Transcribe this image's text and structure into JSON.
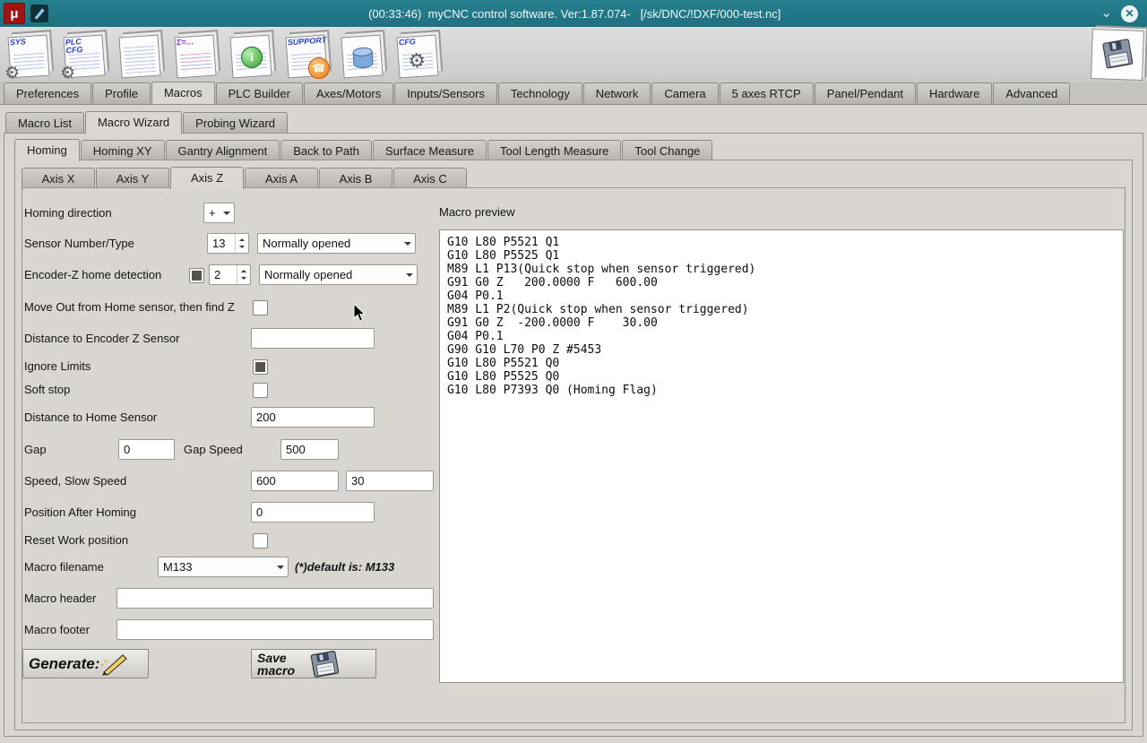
{
  "titlebar": {
    "title": "(00:33:46)  myCNC control software. Ver:1.87.074-   [/sk/DNC/!DXF/000-test.nc]"
  },
  "icons": {
    "mu": "μ",
    "gear": "⚙",
    "info": "i",
    "phone": "☎",
    "chevron": "⌄",
    "close": "✕"
  },
  "toolbar": {
    "buttons": [
      {
        "label": "SYS"
      },
      {
        "label": "PLC CFG"
      },
      {
        "label": ""
      },
      {
        "label": "Σ=…"
      },
      {
        "label": ""
      },
      {
        "label": "SUPPORT"
      },
      {
        "label": ""
      },
      {
        "label": "CFG"
      }
    ]
  },
  "tabs": {
    "main": [
      "Preferences",
      "Profile",
      "Macros",
      "PLC Builder",
      "Axes/Motors",
      "Inputs/Sensors",
      "Technology",
      "Network",
      "Camera",
      "5 axes RTCP",
      "Panel/Pendant",
      "Hardware",
      "Advanced"
    ],
    "sub": [
      "Macro List",
      "Macro Wizard",
      "Probing Wizard"
    ],
    "wizard": [
      "Homing",
      "Homing XY",
      "Gantry Alignment",
      "Back to Path",
      "Surface Measure",
      "Tool Length Measure",
      "Tool Change"
    ],
    "axis": [
      "Axis X",
      "Axis Y",
      "Axis Z",
      "Axis A",
      "Axis B",
      "Axis C"
    ]
  },
  "form": {
    "homing_direction": {
      "label": "Homing direction",
      "value": "+"
    },
    "sensor": {
      "label": "Sensor Number/Type",
      "number": "13",
      "type": "Normally opened"
    },
    "encoder": {
      "label": "Encoder-Z home detection",
      "checked": true,
      "number": "2",
      "type": "Normally opened"
    },
    "move_out": {
      "label": "Move Out from Home sensor, then find Z",
      "checked": false
    },
    "distance_encoder": {
      "label": "Distance to Encoder Z Sensor",
      "value": ""
    },
    "ignore_limits": {
      "label": "Ignore Limits",
      "checked": true
    },
    "soft_stop": {
      "label": "Soft stop",
      "checked": false
    },
    "distance_home": {
      "label": "Distance to Home Sensor",
      "value": "200"
    },
    "gap": {
      "label": "Gap",
      "value": "0"
    },
    "gap_speed": {
      "label": "Gap Speed",
      "value": "500"
    },
    "speed": {
      "label": "Speed, Slow Speed",
      "value": "600",
      "slow_value": "30"
    },
    "position_after": {
      "label": "Position After Homing",
      "value": "0"
    },
    "reset_work": {
      "label": "Reset Work position",
      "checked": false
    },
    "macro_filename": {
      "label": "Macro filename",
      "value": "M133",
      "note": "(*)default is: M133"
    },
    "macro_header": {
      "label": "Macro header",
      "value": ""
    },
    "macro_footer": {
      "label": "Macro footer",
      "value": ""
    }
  },
  "buttons": {
    "generate": "Generate:",
    "save_line1": "Save",
    "save_line2": "macro"
  },
  "preview": {
    "label": "Macro preview",
    "code": "G10 L80 P5521 Q1\nG10 L80 P5525 Q1\nM89 L1 P13(Quick stop when sensor triggered)\nG91 G0 Z   200.0000 F   600.00\nG04 P0.1\nM89 L1 P2(Quick stop when sensor triggered)\nG91 G0 Z  -200.0000 F    30.00\nG04 P0.1\nG90 G10 L70 P0 Z #5453\nG10 L80 P5521 Q0\nG10 L80 P5525 Q0\nG10 L80 P7393 Q0 (Homing Flag)"
  }
}
